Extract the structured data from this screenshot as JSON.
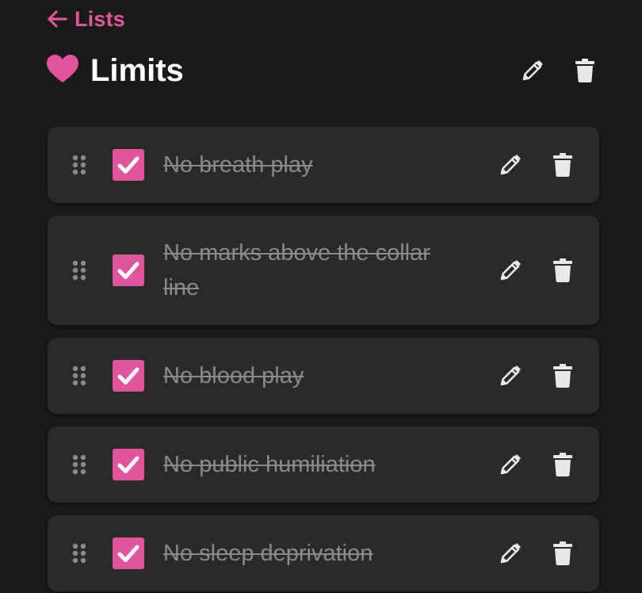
{
  "nav": {
    "back_label": "Lists",
    "back_icon": "arrow-left-icon"
  },
  "header": {
    "title": "Limits",
    "icon": "heart-icon",
    "edit_icon": "pencil-icon",
    "delete_icon": "trash-icon"
  },
  "items": [
    {
      "text": "No breath play",
      "checked": true
    },
    {
      "text": "No marks above the collar line",
      "checked": true
    },
    {
      "text": "No blood play",
      "checked": true
    },
    {
      "text": "No public humiliation",
      "checked": true
    },
    {
      "text": "No sleep deprivation",
      "checked": true
    }
  ],
  "colors": {
    "accent": "#e0559c",
    "background": "#1a1a1a",
    "card": "#2a2a2b",
    "icon": "#e8e8e8",
    "done_text": "#8a8a8a"
  }
}
